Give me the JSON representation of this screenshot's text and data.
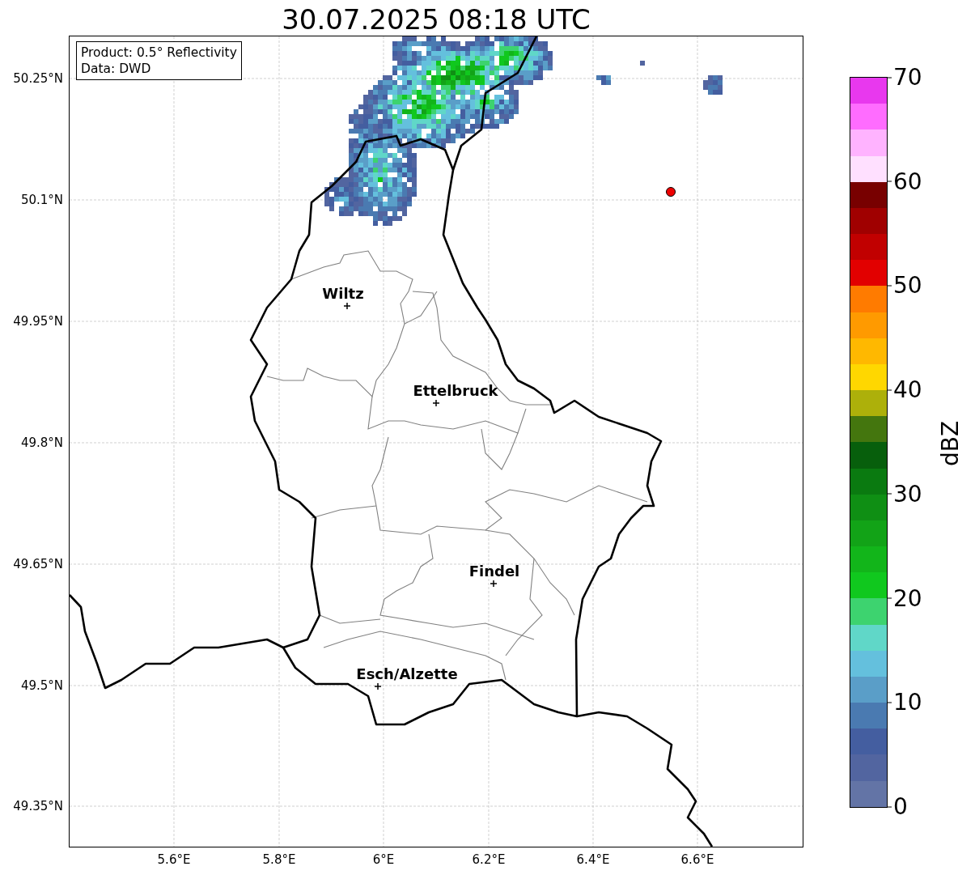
{
  "title": "30.07.2025 08:18 UTC",
  "info": [
    "Product: 0.5° Reflectivity",
    "Data: DWD"
  ],
  "lat_labels": [
    "50.25°N",
    "50.1°N",
    "49.95°N",
    "49.8°N",
    "49.65°N",
    "49.5°N",
    "49.35°N"
  ],
  "lon_labels": [
    "5.6°E",
    "5.8°E",
    "6°E",
    "6.2°E",
    "6.4°E",
    "6.6°E"
  ],
  "places": [
    {
      "name": "Wiltz"
    },
    {
      "name": "Ettelbruck"
    },
    {
      "name": "Findel"
    },
    {
      "name": "Esch/Alzette"
    }
  ],
  "colorbar": {
    "label": "dBZ",
    "ticks": [
      "70",
      "60",
      "50",
      "40",
      "30",
      "20",
      "10",
      "0"
    ],
    "bins": [
      {
        "color": "#6374a6"
      },
      {
        "color": "#5265a0"
      },
      {
        "color": "#445ea0"
      },
      {
        "color": "#4a7ab1"
      },
      {
        "color": "#5a9ec8"
      },
      {
        "color": "#64c0dd"
      },
      {
        "color": "#60d7c8"
      },
      {
        "color": "#3dd36f"
      },
      {
        "color": "#10c81e"
      },
      {
        "color": "#12b51a"
      },
      {
        "color": "#12a317"
      },
      {
        "color": "#0f8f14"
      },
      {
        "color": "#0a7a10"
      },
      {
        "color": "#075f0c"
      },
      {
        "color": "#44760e"
      },
      {
        "color": "#adb00a"
      },
      {
        "color": "#ffd700"
      },
      {
        "color": "#ffb800"
      },
      {
        "color": "#ff9a00"
      },
      {
        "color": "#ff7b00"
      },
      {
        "color": "#e20000"
      },
      {
        "color": "#c10000"
      },
      {
        "color": "#a00000"
      },
      {
        "color": "#780000"
      },
      {
        "color": "#ffe0ff"
      },
      {
        "color": "#ffb3ff"
      },
      {
        "color": "#ff6cff"
      },
      {
        "color": "#e838ee"
      }
    ]
  }
}
